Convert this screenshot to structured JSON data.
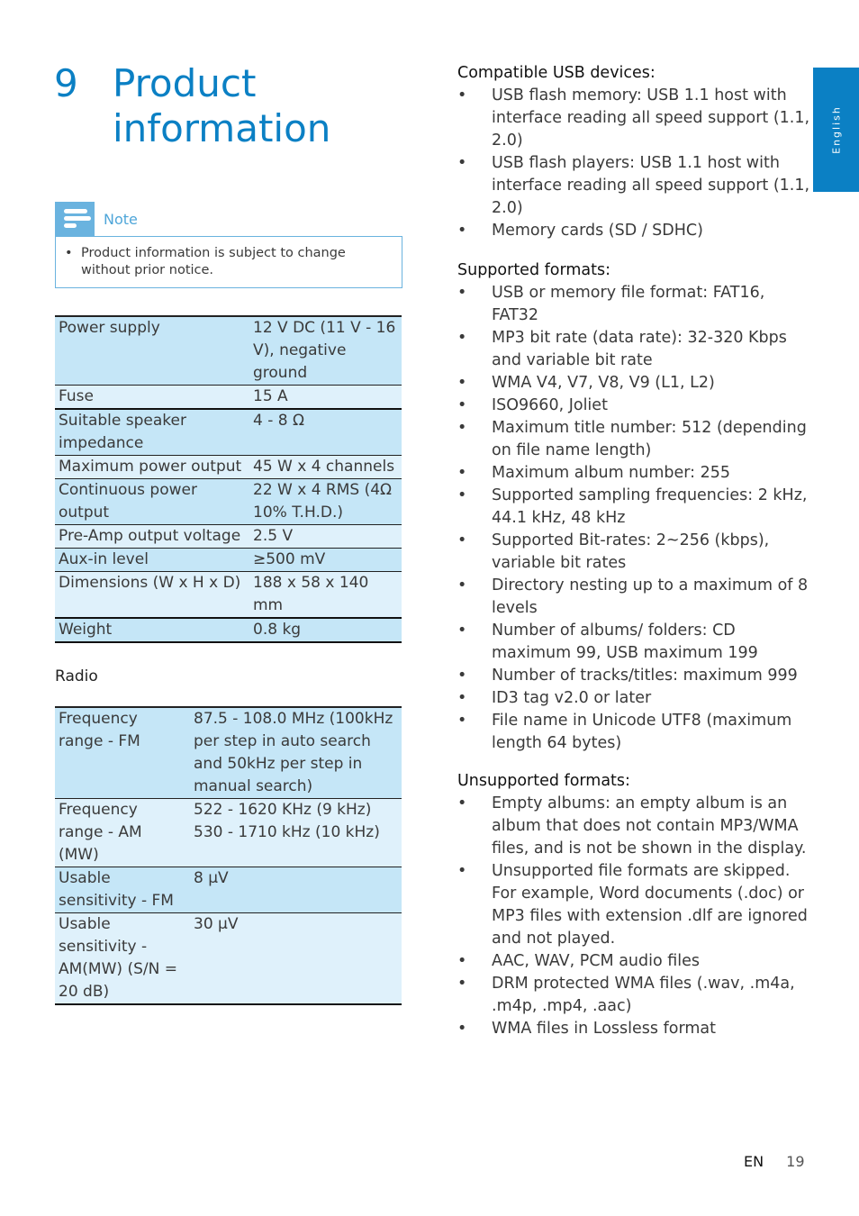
{
  "chapter": {
    "number": "9",
    "title": "Product information"
  },
  "side_tab": "English",
  "note": {
    "label": "Note",
    "items": [
      "Product information is subject to change without prior notice."
    ]
  },
  "general_specs": [
    {
      "key": "Power supply",
      "value": "12 V DC (11 V - 16 V), negative ground"
    },
    {
      "key": "Fuse",
      "value": "15 A"
    },
    {
      "key": "Suitable speaker impedance",
      "value": "4 - 8 Ω"
    },
    {
      "key": "Maximum power output",
      "value": "45 W x 4 channels"
    },
    {
      "key": "Continuous power output",
      "value": "22 W x 4 RMS (4Ω 10% T.H.D.)"
    },
    {
      "key": "Pre-Amp output voltage",
      "value": "2.5 V"
    },
    {
      "key": "Aux-in level",
      "value": "≥500 mV"
    },
    {
      "key": "Dimensions (W x H x D)",
      "value": "188 x 58 x 140 mm"
    },
    {
      "key": "Weight",
      "value": "0.8 kg"
    }
  ],
  "radio": {
    "heading": "Radio",
    "specs": [
      {
        "key": "Frequency range - FM",
        "value": "87.5 - 108.0 MHz (100kHz per step in auto search and 50kHz per step in manual search)"
      },
      {
        "key": "Frequency range - AM (MW)",
        "value": "522 - 1620 KHz (9 kHz) 530 - 1710 kHz (10 kHz)"
      },
      {
        "key": "Usable sensitivity - FM",
        "value": "8 μV"
      },
      {
        "key": "Usable sensitivity - AM(MW) (S/N = 20 dB)",
        "value": "30 μV"
      }
    ]
  },
  "usb_devices": {
    "heading": "Compatible USB devices:",
    "items": [
      "USB flash memory: USB 1.1 host with interface reading all speed support (1.1, 2.0)",
      "USB flash players: USB 1.1 host with interface reading all speed support (1.1, 2.0)",
      "Memory cards (SD / SDHC)"
    ]
  },
  "supported_formats": {
    "heading": "Supported formats:",
    "items": [
      "USB or memory file format: FAT16, FAT32",
      "MP3 bit rate (data rate): 32-320 Kbps and variable bit rate",
      "WMA V4, V7, V8, V9 (L1, L2)",
      "ISO9660, Joliet",
      "Maximum title number: 512 (depending on file name length)",
      "Maximum album number: 255",
      "Supported sampling frequencies: 2 kHz, 44.1 kHz, 48 kHz",
      "Supported Bit-rates: 2~256 (kbps), variable bit rates",
      "Directory nesting up to a maximum of 8 levels",
      "Number of albums/ folders: CD maximum 99, USB maximum 199",
      "Number of tracks/titles: maximum 999",
      "ID3 tag v2.0 or later",
      "File name in Unicode UTF8 (maximum length 64 bytes)"
    ]
  },
  "unsupported_formats": {
    "heading": "Unsupported formats:",
    "items": [
      "Empty albums: an empty album is an album that does not contain MP3/WMA files, and is not be shown in the display.",
      "Unsupported file formats are skipped. For example, Word documents (.doc) or MP3 files with extension .dlf are ignored and not played.",
      "AAC, WAV, PCM audio files",
      "DRM protected WMA files (.wav, .m4a, .m4p, .mp4, .aac)",
      "WMA files in Lossless format"
    ]
  },
  "footer": {
    "lang": "EN",
    "page": "19"
  }
}
